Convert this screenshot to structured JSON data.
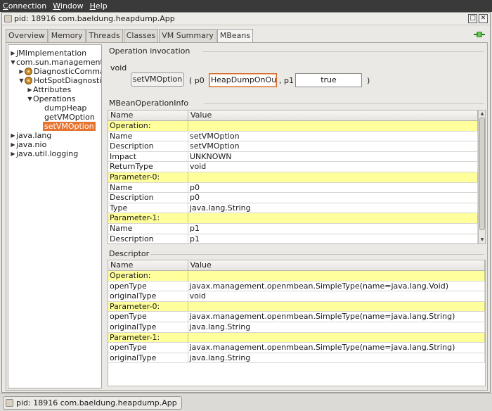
{
  "menubar": {
    "items": [
      {
        "first": "C",
        "rest": "onnection"
      },
      {
        "first": "W",
        "rest": "indow"
      },
      {
        "first": "H",
        "rest": "elp"
      }
    ]
  },
  "window": {
    "title": "pid: 18916 com.baeldung.heapdump.App"
  },
  "tabs": [
    "Overview",
    "Memory",
    "Threads",
    "Classes",
    "VM Summary",
    "MBeans"
  ],
  "tree": {
    "nodes": [
      "JMImplementation",
      "com.sun.management",
      "DiagnosticCommand",
      "HotSpotDiagnostic",
      "Attributes",
      "Operations",
      "dumpHeap",
      "getVMOption",
      "setVMOption",
      "java.lang",
      "java.nio",
      "java.util.logging"
    ]
  },
  "invocation": {
    "title": "Operation invocation",
    "return_type": "void",
    "button": "setVMOption",
    "open_paren": "( p0",
    "p0_value": "HeapDumpOnOutOfMemoryError",
    "sep": ", p1",
    "p1_value": "true",
    "close_paren": ")"
  },
  "opinfo": {
    "title": "MBeanOperationInfo",
    "headers": [
      "Name",
      "Value"
    ],
    "rows": [
      [
        "Operation:",
        ""
      ],
      [
        "Name",
        "setVMOption"
      ],
      [
        "Description",
        "setVMOption"
      ],
      [
        "Impact",
        "UNKNOWN"
      ],
      [
        "ReturnType",
        "void"
      ],
      [
        "Parameter-0:",
        ""
      ],
      [
        "Name",
        "p0"
      ],
      [
        "Description",
        "p0"
      ],
      [
        "Type",
        "java.lang.String"
      ],
      [
        "Parameter-1:",
        ""
      ],
      [
        "Name",
        "p1"
      ],
      [
        "Description",
        "p1"
      ]
    ]
  },
  "descriptor": {
    "title": "Descriptor",
    "headers": [
      "Name",
      "Value"
    ],
    "rows": [
      [
        "Operation:",
        ""
      ],
      [
        "openType",
        "javax.management.openmbean.SimpleType(name=java.lang.Void)"
      ],
      [
        "originalType",
        "void"
      ],
      [
        "Parameter-0:",
        ""
      ],
      [
        "openType",
        "javax.management.openmbean.SimpleType(name=java.lang.String)"
      ],
      [
        "originalType",
        "java.lang.String"
      ],
      [
        "Parameter-1:",
        ""
      ],
      [
        "openType",
        "javax.management.openmbean.SimpleType(name=java.lang.String)"
      ],
      [
        "originalType",
        "java.lang.String"
      ]
    ]
  },
  "taskbar": {
    "item": "pid: 18916 com.baeldung.heapdump.App"
  },
  "colors": {
    "selection": "#e67431",
    "group_row": "#ffff9c",
    "connected_icon": "#3a9a2a"
  },
  "icons": {
    "connection": "plug-connected-icon",
    "bean": "mbean-bean-icon"
  }
}
